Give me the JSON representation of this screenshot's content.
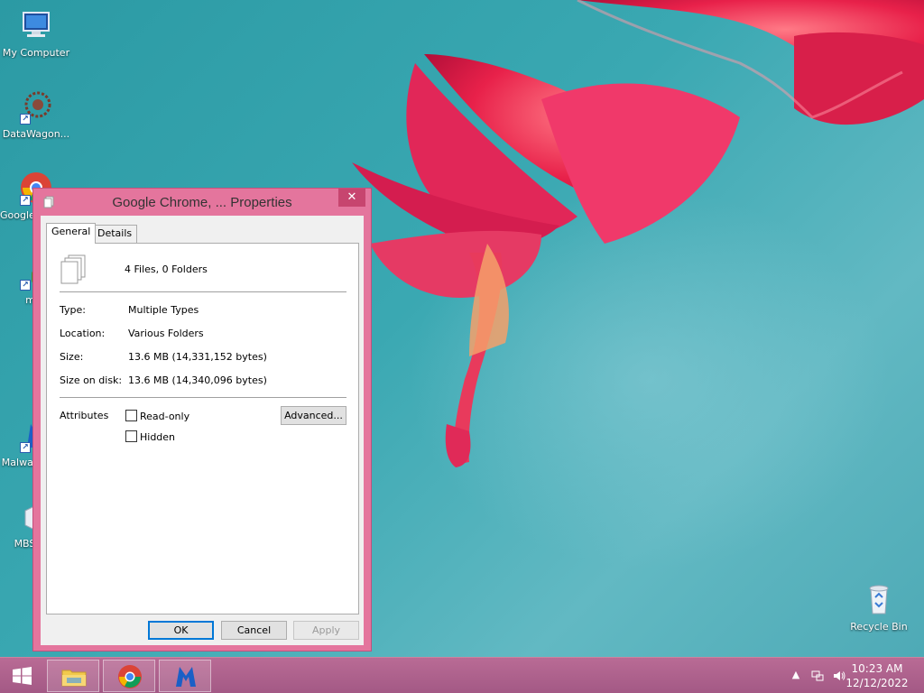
{
  "desktop": {
    "icons": [
      {
        "label": "My Computer"
      },
      {
        "label": "DataWagon..."
      },
      {
        "label": "Google Chrome"
      },
      {
        "label": "mini"
      },
      {
        "label": "Malwarebytes"
      },
      {
        "label": "MBSetup"
      },
      {
        "label": "Recycle Bin"
      }
    ]
  },
  "dialog": {
    "title": "Google Chrome, ... Properties",
    "close_label": "✕",
    "tabs": [
      {
        "label": "General"
      },
      {
        "label": "Details"
      }
    ],
    "general": {
      "summary": "4 Files, 0 Folders",
      "type_label": "Type:",
      "type_value": "Multiple Types",
      "location_label": "Location:",
      "location_value": "Various Folders",
      "size_label": "Size:",
      "size_value": "13.6 MB (14,331,152 bytes)",
      "size_on_disk_label": "Size on disk:",
      "size_on_disk_value": "13.6 MB (14,340,096 bytes)",
      "attributes_label": "Attributes",
      "readonly_label": "Read-only",
      "hidden_label": "Hidden",
      "advanced_label": "Advanced..."
    },
    "buttons": {
      "ok": "OK",
      "cancel": "Cancel",
      "apply": "Apply"
    }
  },
  "taskbar": {
    "pinned": [
      "file-explorer",
      "google-chrome",
      "malwarebytes"
    ],
    "time": "10:23 AM",
    "date": "12/12/2022"
  },
  "colors": {
    "accent": "#e4759d",
    "taskbar": "#a35985",
    "desktop": "#3aa8b2"
  }
}
